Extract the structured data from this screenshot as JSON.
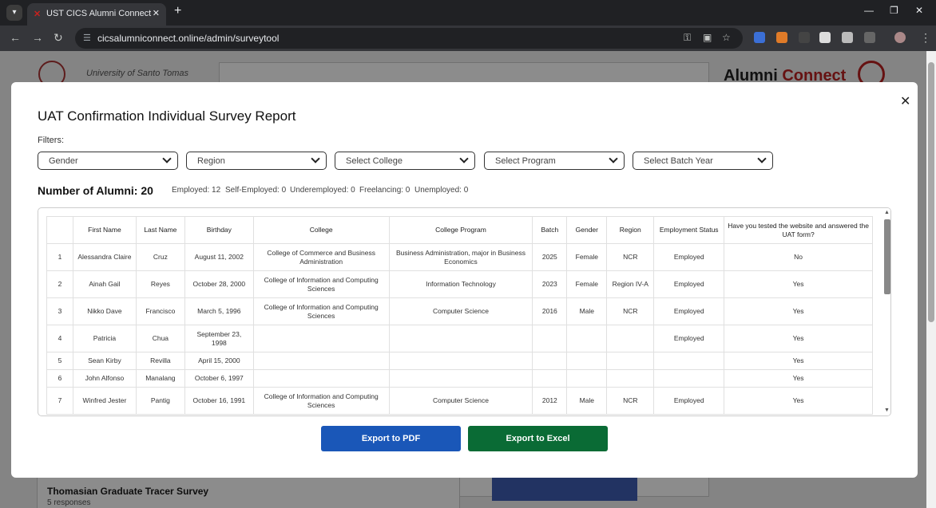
{
  "browser": {
    "tab_title": "UST CICS Alumni Connect",
    "tab_menu_icon": "chevron-down-icon",
    "url": "cicsalumniconnect.online/admin/surveytool"
  },
  "background": {
    "university": "University of Santo Tomas",
    "brand_prefix": "Alumni",
    "brand_suffix": "Connect",
    "card_title": "Thomasian Graduate Tracer Survey",
    "card_sub": "5 responses"
  },
  "modal": {
    "title": "UAT Confirmation Individual Survey Report",
    "filters_label": "Filters:",
    "filters": [
      "Gender",
      "Region",
      "Select College",
      "Select Program",
      "Select Batch Year"
    ],
    "count_label": "Number of Alumni: 20",
    "stats": [
      "Employed: 12",
      "Self-Employed: 0",
      "Underemployed: 0",
      "Freelancing: 0",
      "Unemployed: 0"
    ],
    "table": {
      "headers": [
        "",
        "First Name",
        "Last Name",
        "Birthday",
        "College",
        "College Program",
        "Batch",
        "Gender",
        "Region",
        "Employment Status",
        "Have you tested the website and answered the UAT form?"
      ],
      "rows": [
        [
          "1",
          "Alessandra Claire",
          "Cruz",
          "August 11, 2002",
          "College of Commerce and Business Administration",
          "Business Administration, major in Business Economics",
          "2025",
          "Female",
          "NCR",
          "Employed",
          "No"
        ],
        [
          "2",
          "Ainah Gail",
          "Reyes",
          "October 28, 2000",
          "College of Information and Computing Sciences",
          "Information Technology",
          "2023",
          "Female",
          "Region IV-A",
          "Employed",
          "Yes"
        ],
        [
          "3",
          "Nikko Dave",
          "Francisco",
          "March 5, 1996",
          "College of Information and Computing Sciences",
          "Computer Science",
          "2016",
          "Male",
          "NCR",
          "Employed",
          "Yes"
        ],
        [
          "4",
          "Patricia",
          "Chua",
          "September 23, 1998",
          "",
          "",
          "",
          "",
          "",
          "Employed",
          "Yes"
        ],
        [
          "5",
          "Sean Kirby",
          "Revilla",
          "April 15, 2000",
          "",
          "",
          "",
          "",
          "",
          "",
          "Yes"
        ],
        [
          "6",
          "John Alfonso",
          "Manalang",
          "October 6, 1997",
          "",
          "",
          "",
          "",
          "",
          "",
          "Yes"
        ],
        [
          "7",
          "Winfred Jester",
          "Pantig",
          "October 16, 1991",
          "College of Information and Computing Sciences",
          "Computer Science",
          "2012",
          "Male",
          "NCR",
          "Employed",
          "Yes"
        ]
      ]
    },
    "export_pdf": "Export to PDF",
    "export_excel": "Export to Excel"
  }
}
